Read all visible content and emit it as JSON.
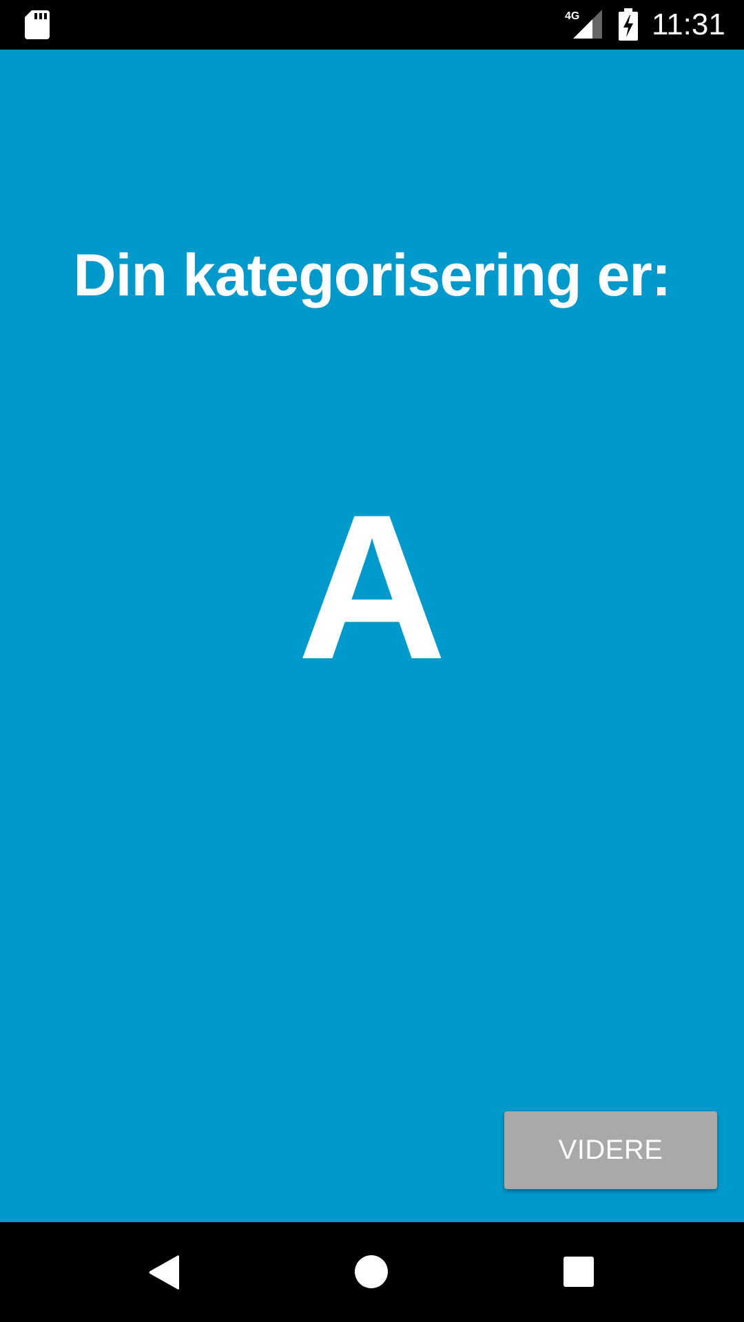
{
  "status_bar": {
    "network_label": "4G",
    "time": "11:31",
    "icons": [
      "sd-card-icon",
      "signal-icon",
      "battery-charging-icon"
    ]
  },
  "main": {
    "heading": "Din kategorisering er:",
    "category": "A",
    "background_color": "#0099cc"
  },
  "actions": {
    "next_label": "VIDERE",
    "next_button_color": "#a9a9a9"
  },
  "nav_bar": {
    "icons": [
      "back-icon",
      "home-icon",
      "recents-icon"
    ]
  }
}
